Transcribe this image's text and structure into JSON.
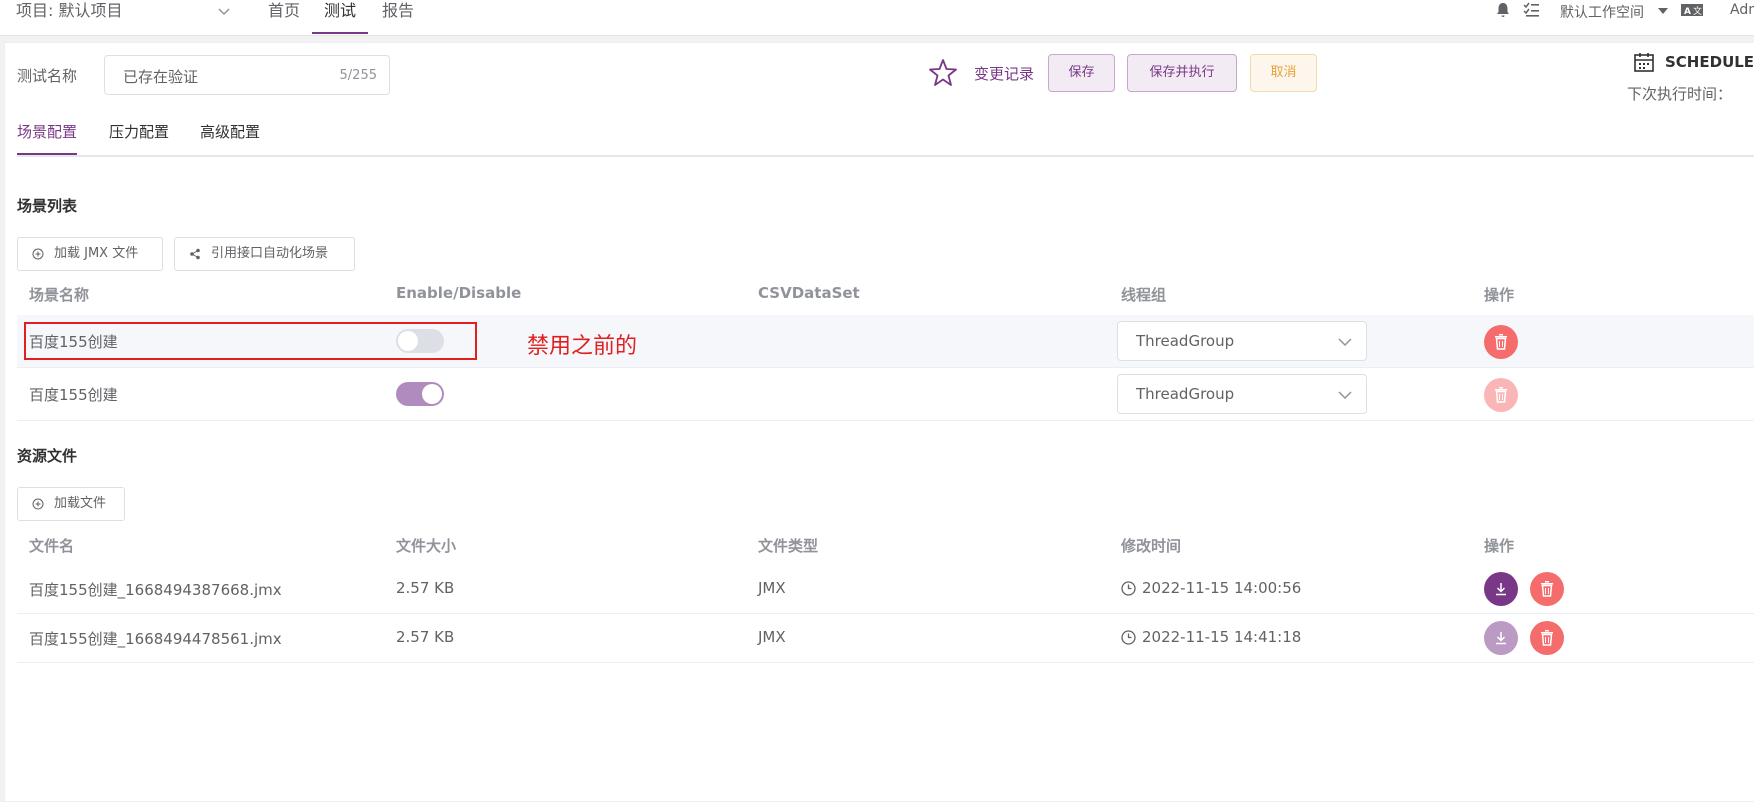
{
  "topbar": {
    "project": "项目: 默认项目",
    "nav": [
      "首页",
      "测试",
      "报告"
    ],
    "workspace": "默认工作空间",
    "user": "Adm"
  },
  "header": {
    "test_name_label": "测试名称",
    "test_name_value": "已存在验证",
    "char_count": "5/255",
    "change_log": "变更记录",
    "save": "保存",
    "save_run": "保存并执行",
    "cancel": "取消",
    "schedule": "SCHEDULE",
    "next_run_label": "下次执行时间："
  },
  "tabs": [
    "场景配置",
    "压力配置",
    "高级配置"
  ],
  "scenes": {
    "title": "场景列表",
    "load_jmx": "加载 JMX 文件",
    "ref_api": "引用接口自动化场景",
    "columns": [
      "场景名称",
      "Enable/Disable",
      "CSVDataSet",
      "线程组",
      "操作"
    ],
    "rows": [
      {
        "name": "百度155创建",
        "enabled": false,
        "thread_group": "ThreadGroup"
      },
      {
        "name": "百度155创建",
        "enabled": true,
        "thread_group": "ThreadGroup"
      }
    ]
  },
  "annotation": "禁用之前的",
  "resources": {
    "title": "资源文件",
    "load_file": "加载文件",
    "columns": [
      "文件名",
      "文件大小",
      "文件类型",
      "修改时间",
      "操作"
    ],
    "rows": [
      {
        "name": "百度155创建_1668494387668.jmx",
        "size": "2.57 KB",
        "type": "JMX",
        "modified": "2022-11-15 14:00:56"
      },
      {
        "name": "百度155创建_1668494478561.jmx",
        "size": "2.57 KB",
        "type": "JMX",
        "modified": "2022-11-15 14:41:18"
      }
    ]
  },
  "colors": {
    "primary": "#783887",
    "danger": "#f56c6c",
    "warning": "#e6a23c"
  },
  "icons": [
    "chevron-down-icon",
    "bell-icon",
    "task-list-icon",
    "language-icon",
    "star-icon",
    "calendar-icon",
    "plus-circle-icon",
    "share-icon",
    "delete-icon",
    "download-icon",
    "clock-icon"
  ]
}
